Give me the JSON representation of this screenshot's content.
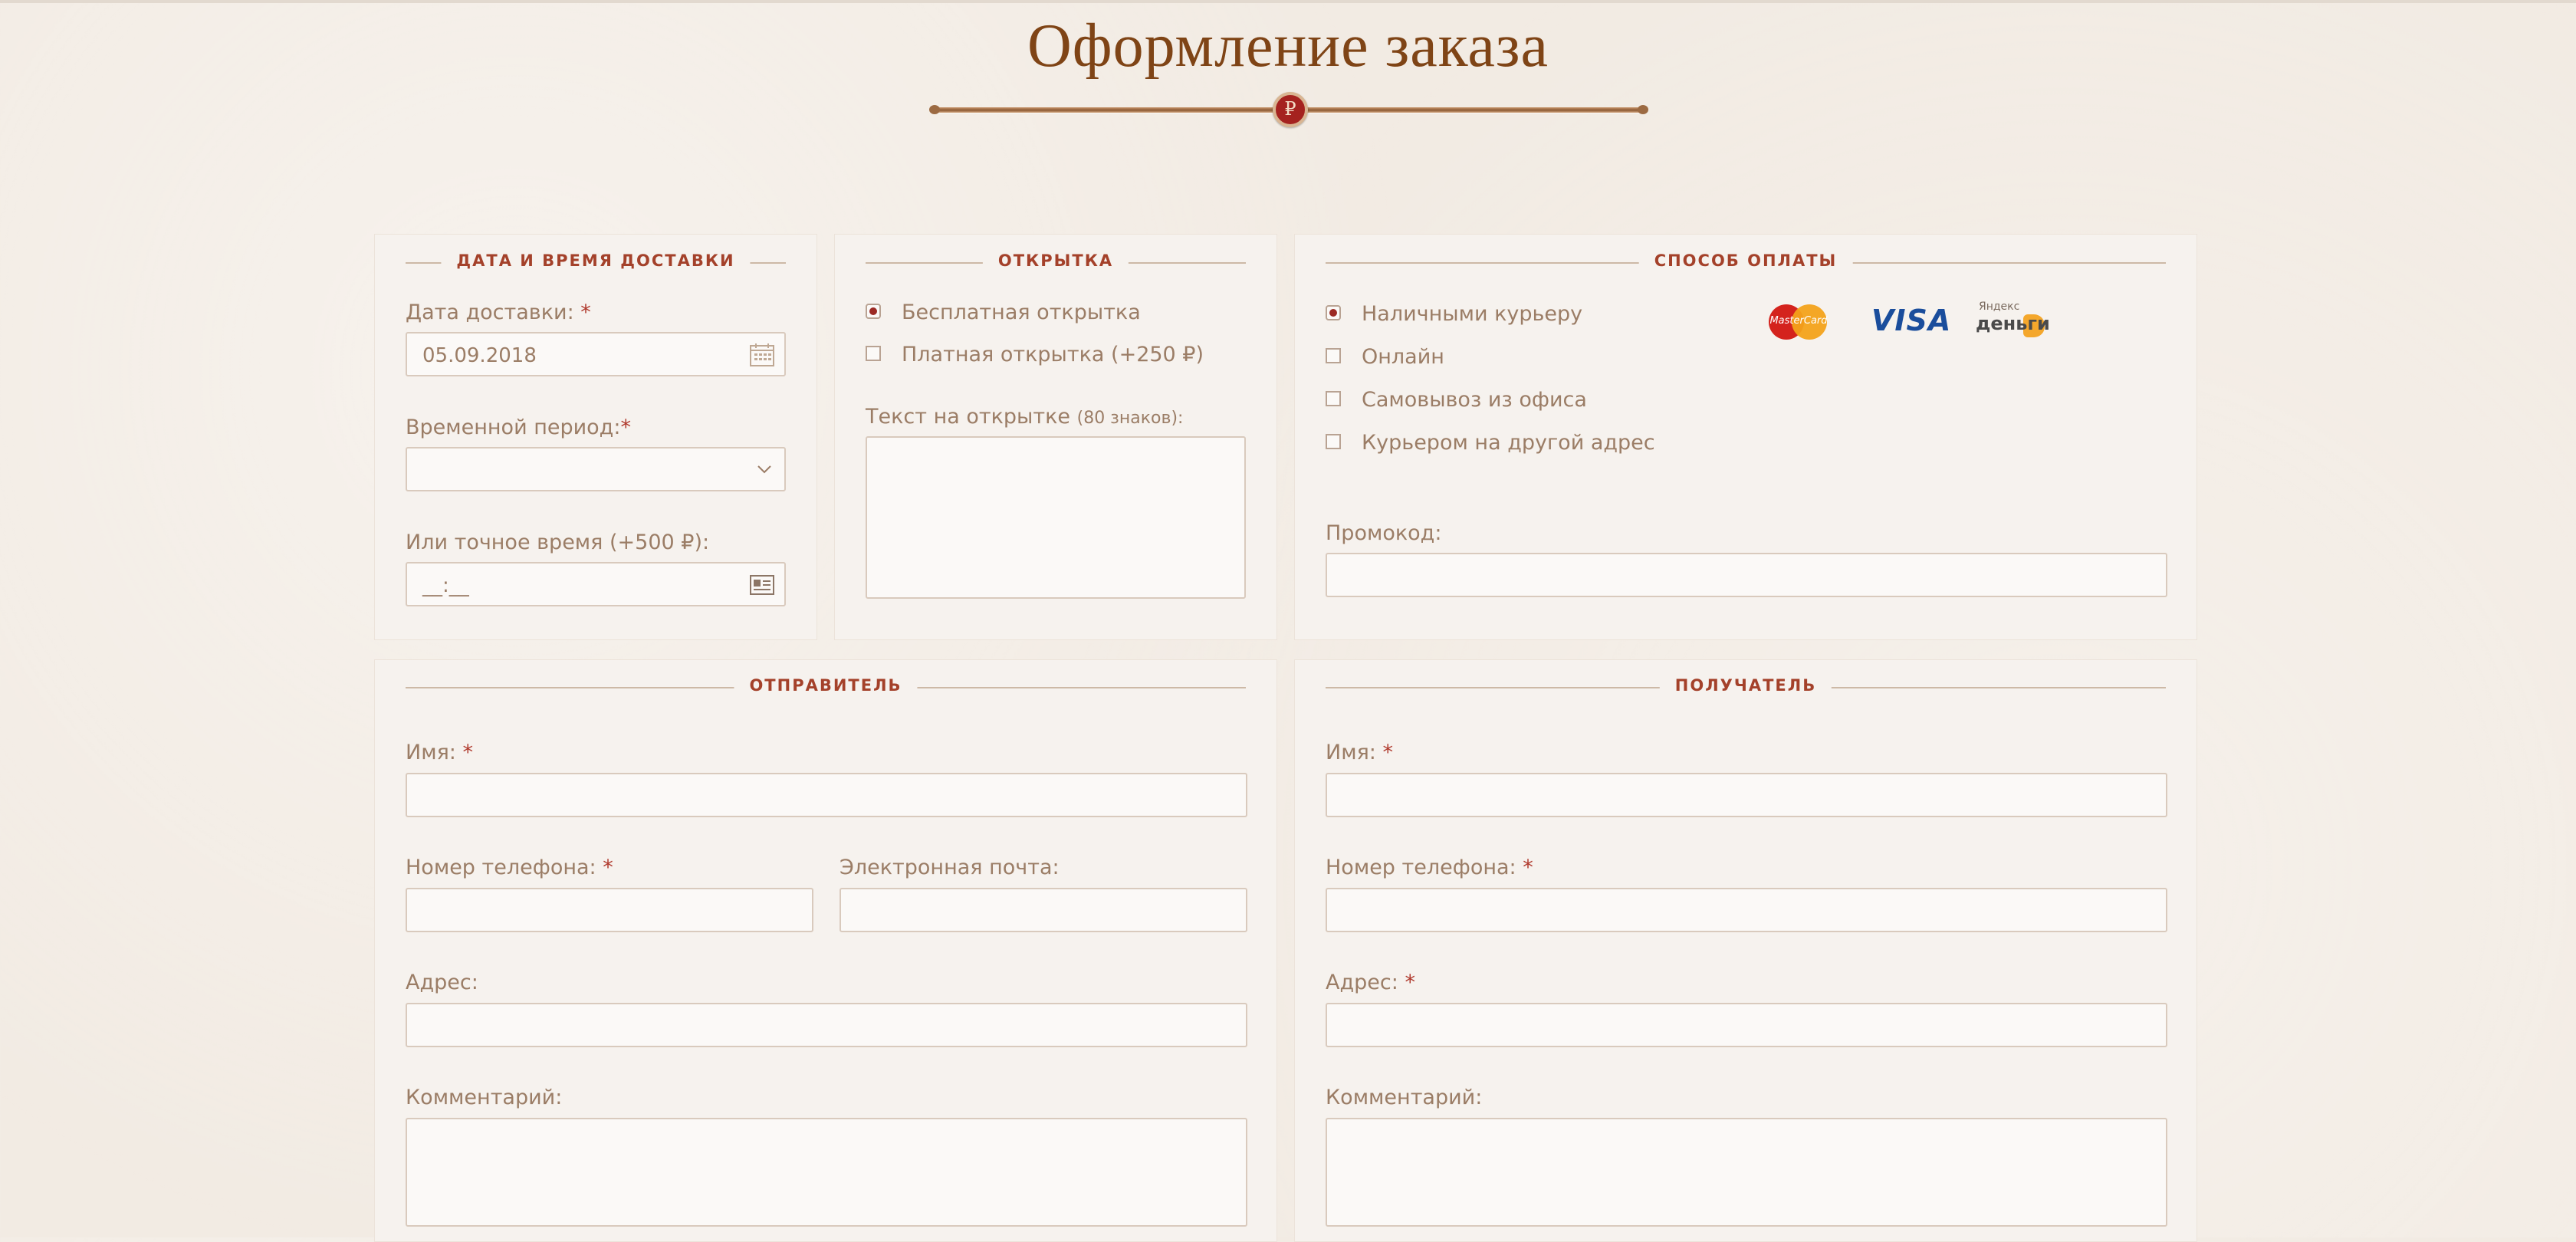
{
  "page": {
    "title": "Оформление заказа",
    "currency_sign": "₽"
  },
  "delivery": {
    "legend": "ДАТА И ВРЕМЯ ДОСТАВКИ",
    "date_label": "Дата доставки:",
    "date_value": "05.09.2018",
    "period_label": "Временной период:",
    "period_value": "",
    "exact_time_label": "Или точное время (+500 ₽):",
    "exact_time_value": "__:__",
    "required_mark": "*"
  },
  "card": {
    "legend": "ОТКРЫТКА",
    "options": [
      {
        "label": "Бесплатная открытка",
        "checked": true
      },
      {
        "label": "Платная открытка (+250 ₽)",
        "checked": false
      }
    ],
    "text_label": "Текст на открытке",
    "text_hint": "(80 знаков):",
    "text_value": ""
  },
  "payment": {
    "legend": "СПОСОБ ОПЛАТЫ",
    "options": [
      {
        "label": "Наличными курьеру",
        "checked": true
      },
      {
        "label": "Онлайн",
        "checked": false
      },
      {
        "label": "Самовывоз из офиса",
        "checked": false
      },
      {
        "label": "Курьером на другой адрес",
        "checked": false
      }
    ],
    "logos": {
      "mastercard": "MasterCard",
      "visa": "VISA",
      "yandex_top": "Яндекс",
      "yandex_bottom": "деньги"
    },
    "promo_label": "Промокод:",
    "promo_value": ""
  },
  "sender": {
    "legend": "ОТПРАВИТЕЛЬ",
    "name_label": "Имя:",
    "phone_label": "Номер телефона:",
    "email_label": "Электронная почта:",
    "address_label": "Адрес:",
    "comment_label": "Комментарий:",
    "required_mark": "*"
  },
  "recipient": {
    "legend": "ПОЛУЧАТЕЛЬ",
    "name_label": "Имя:",
    "phone_label": "Номер телефона:",
    "address_label": "Адрес:",
    "comment_label": "Комментарий:",
    "required_mark": "*"
  },
  "colors": {
    "accent": "#a4412a",
    "title": "#7f4416",
    "text": "#9b7d66",
    "panel": "#f6f2ee",
    "border": "#d9cabd"
  }
}
